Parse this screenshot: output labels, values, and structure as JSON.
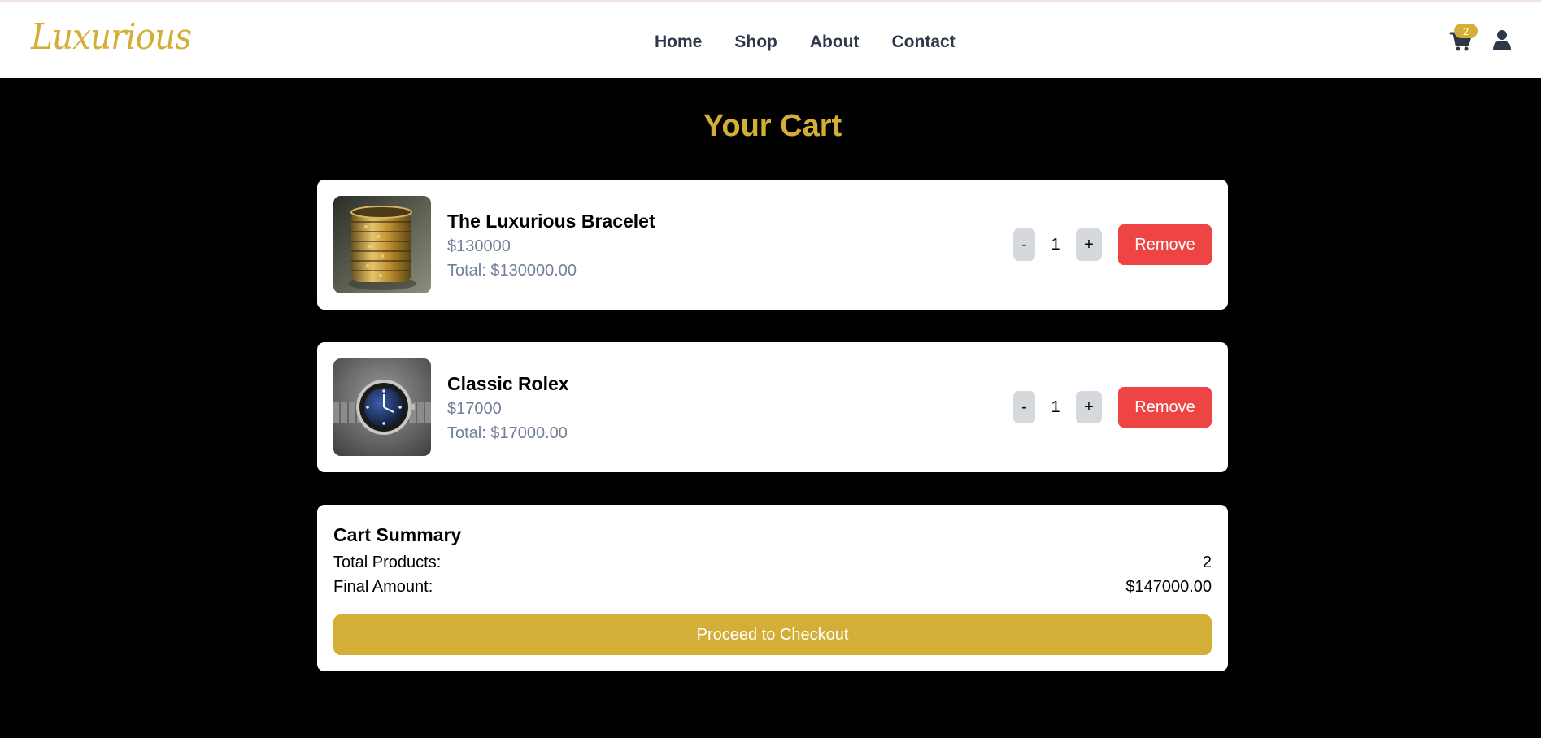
{
  "header": {
    "logo": "Luxurious",
    "nav": [
      "Home",
      "Shop",
      "About",
      "Contact"
    ],
    "cart_count": "2",
    "icons": {
      "cart": "shopping-cart-icon",
      "user": "user-icon"
    }
  },
  "page": {
    "title": "Your Cart"
  },
  "cart": {
    "items": [
      {
        "name": "The Luxurious Bracelet",
        "price": "$130000",
        "total": "Total: $130000.00",
        "quantity": "1",
        "image": "gold-bracelet-stack-image",
        "decrement_label": "-",
        "increment_label": "+",
        "remove_label": "Remove"
      },
      {
        "name": "Classic Rolex",
        "price": "$17000",
        "total": "Total: $17000.00",
        "quantity": "1",
        "image": "rolex-watch-image",
        "decrement_label": "-",
        "increment_label": "+",
        "remove_label": "Remove"
      }
    ]
  },
  "summary": {
    "title": "Cart Summary",
    "total_products_label": "Total Products:",
    "total_products_value": "2",
    "final_amount_label": "Final Amount:",
    "final_amount_value": "$147000.00",
    "checkout_label": "Proceed to Checkout"
  },
  "colors": {
    "brand_gold": "#d4af37",
    "remove_red": "#ef4444",
    "nav_text": "#2d3748",
    "muted_text": "#718096",
    "qty_button_bg": "#d5d8dd",
    "page_bg": "#000000"
  }
}
